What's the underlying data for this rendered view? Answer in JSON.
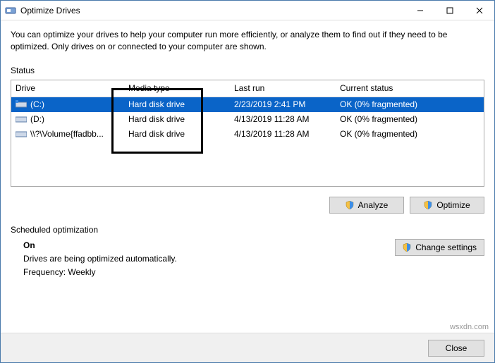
{
  "window": {
    "title": "Optimize Drives",
    "intro": "You can optimize your drives to help your computer run more efficiently, or analyze them to find out if they need to be optimized. Only drives on or connected to your computer are shown."
  },
  "status": {
    "label": "Status",
    "headers": {
      "drive": "Drive",
      "media": "Media type",
      "last": "Last run",
      "status": "Current status"
    },
    "rows": [
      {
        "name": "(C:)",
        "media": "Hard disk drive",
        "last": "2/23/2019 2:41 PM",
        "status": "OK (0% fragmented)",
        "selected": true,
        "icon": "drive-os"
      },
      {
        "name": "(D:)",
        "media": "Hard disk drive",
        "last": "4/13/2019 11:28 AM",
        "status": "OK (0% fragmented)",
        "selected": false,
        "icon": "drive"
      },
      {
        "name": "\\\\?\\Volume{ffadbb...",
        "media": "Hard disk drive",
        "last": "4/13/2019 11:28 AM",
        "status": "OK (0% fragmented)",
        "selected": false,
        "icon": "drive"
      }
    ]
  },
  "buttons": {
    "analyze": "Analyze",
    "optimize": "Optimize",
    "change": "Change settings",
    "close": "Close"
  },
  "scheduled": {
    "label": "Scheduled optimization",
    "state": "On",
    "line1": "Drives are being optimized automatically.",
    "line2": "Frequency: Weekly"
  },
  "watermark": "wsxdn.com"
}
